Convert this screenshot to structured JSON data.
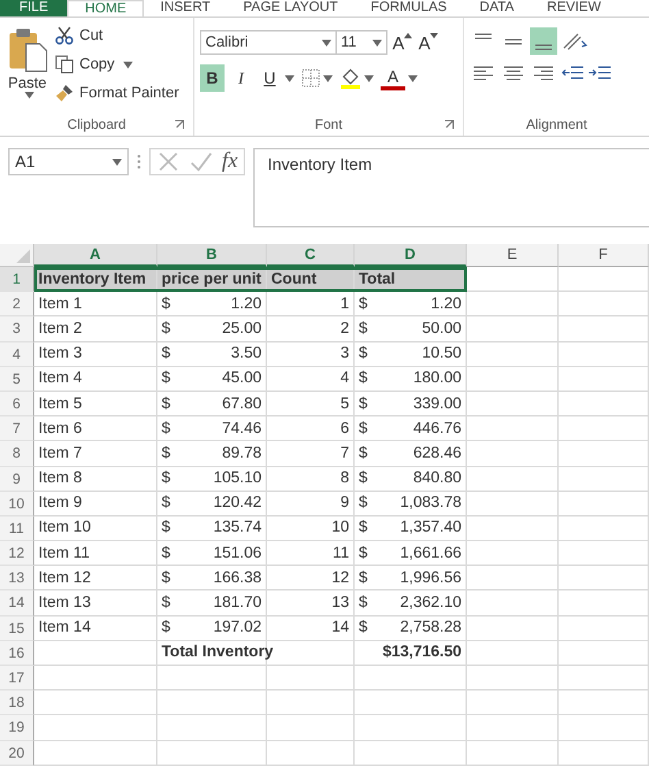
{
  "tabs": [
    {
      "label": "FILE",
      "kind": "file",
      "selected": false
    },
    {
      "label": "HOME",
      "kind": "tab",
      "selected": true
    },
    {
      "label": "INSERT",
      "kind": "tab",
      "selected": false
    },
    {
      "label": "PAGE LAYOUT",
      "kind": "tab",
      "selected": false
    },
    {
      "label": "FORMULAS",
      "kind": "tab",
      "selected": false
    },
    {
      "label": "DATA",
      "kind": "tab",
      "selected": false
    },
    {
      "label": "REVIEW",
      "kind": "tab",
      "selected": false
    }
  ],
  "clipboard": {
    "paste": "Paste",
    "cut": "Cut",
    "copy": "Copy",
    "format_painter": "Format Painter",
    "label": "Clipboard"
  },
  "font": {
    "name": "Calibri",
    "size": "11",
    "grow": "A",
    "shrink": "A",
    "bold": {
      "label": "B",
      "selected": true
    },
    "italic": {
      "label": "I",
      "selected": false
    },
    "underline": {
      "label": "U",
      "selected": false
    },
    "color_letter": "A",
    "label": "Font"
  },
  "alignment": {
    "vertical": [
      {
        "selected": false
      },
      {
        "selected": false
      },
      {
        "selected": true
      }
    ],
    "horizontal": [
      {
        "selected": false
      },
      {
        "selected": false
      },
      {
        "selected": false
      }
    ],
    "label": "Alignment"
  },
  "name_box": "A1",
  "fx": "fx",
  "formula": "Inventory Item",
  "columns": [
    {
      "letter": "A",
      "selected": true
    },
    {
      "letter": "B",
      "selected": true
    },
    {
      "letter": "C",
      "selected": true
    },
    {
      "letter": "D",
      "selected": true
    },
    {
      "letter": "E",
      "selected": false
    },
    {
      "letter": "F",
      "selected": false
    }
  ],
  "rows": [
    {
      "number": "1",
      "kind": "header",
      "selected": true,
      "cells": [
        {
          "kind": "text",
          "text": "Inventory Item"
        },
        {
          "kind": "text",
          "text": "price per unit"
        },
        {
          "kind": "text",
          "text": "Count"
        },
        {
          "kind": "text",
          "text": "Total"
        }
      ]
    },
    {
      "number": "2",
      "kind": "data",
      "selected": false,
      "cells": [
        {
          "kind": "text",
          "text": "Item 1"
        },
        {
          "kind": "currency",
          "sign": "$",
          "text": "1.20"
        },
        {
          "kind": "number",
          "text": "1"
        },
        {
          "kind": "currency",
          "sign": "$",
          "text": "1.20"
        }
      ]
    },
    {
      "number": "3",
      "kind": "data",
      "selected": false,
      "cells": [
        {
          "kind": "text",
          "text": "Item 2"
        },
        {
          "kind": "currency",
          "sign": "$",
          "text": "25.00"
        },
        {
          "kind": "number",
          "text": "2"
        },
        {
          "kind": "currency",
          "sign": "$",
          "text": "50.00"
        }
      ]
    },
    {
      "number": "4",
      "kind": "data",
      "selected": false,
      "cells": [
        {
          "kind": "text",
          "text": "Item 3"
        },
        {
          "kind": "currency",
          "sign": "$",
          "text": "3.50"
        },
        {
          "kind": "number",
          "text": "3"
        },
        {
          "kind": "currency",
          "sign": "$",
          "text": "10.50"
        }
      ]
    },
    {
      "number": "5",
      "kind": "data",
      "selected": false,
      "cells": [
        {
          "kind": "text",
          "text": "Item 4"
        },
        {
          "kind": "currency",
          "sign": "$",
          "text": "45.00"
        },
        {
          "kind": "number",
          "text": "4"
        },
        {
          "kind": "currency",
          "sign": "$",
          "text": "180.00"
        }
      ]
    },
    {
      "number": "6",
      "kind": "data",
      "selected": false,
      "cells": [
        {
          "kind": "text",
          "text": "Item 5"
        },
        {
          "kind": "currency",
          "sign": "$",
          "text": "67.80"
        },
        {
          "kind": "number",
          "text": "5"
        },
        {
          "kind": "currency",
          "sign": "$",
          "text": "339.00"
        }
      ]
    },
    {
      "number": "7",
      "kind": "data",
      "selected": false,
      "cells": [
        {
          "kind": "text",
          "text": "Item 6"
        },
        {
          "kind": "currency",
          "sign": "$",
          "text": "74.46"
        },
        {
          "kind": "number",
          "text": "6"
        },
        {
          "kind": "currency",
          "sign": "$",
          "text": "446.76"
        }
      ]
    },
    {
      "number": "8",
      "kind": "data",
      "selected": false,
      "cells": [
        {
          "kind": "text",
          "text": "Item 7"
        },
        {
          "kind": "currency",
          "sign": "$",
          "text": "89.78"
        },
        {
          "kind": "number",
          "text": "7"
        },
        {
          "kind": "currency",
          "sign": "$",
          "text": "628.46"
        }
      ]
    },
    {
      "number": "9",
      "kind": "data",
      "selected": false,
      "cells": [
        {
          "kind": "text",
          "text": "Item 8"
        },
        {
          "kind": "currency",
          "sign": "$",
          "text": "105.10"
        },
        {
          "kind": "number",
          "text": "8"
        },
        {
          "kind": "currency",
          "sign": "$",
          "text": "840.80"
        }
      ]
    },
    {
      "number": "10",
      "kind": "data",
      "selected": false,
      "cells": [
        {
          "kind": "text",
          "text": "Item 9"
        },
        {
          "kind": "currency",
          "sign": "$",
          "text": "120.42"
        },
        {
          "kind": "number",
          "text": "9"
        },
        {
          "kind": "currency",
          "sign": "$",
          "text": "1,083.78"
        }
      ]
    },
    {
      "number": "11",
      "kind": "data",
      "selected": false,
      "cells": [
        {
          "kind": "text",
          "text": "Item 10"
        },
        {
          "kind": "currency",
          "sign": "$",
          "text": "135.74"
        },
        {
          "kind": "number",
          "text": "10"
        },
        {
          "kind": "currency",
          "sign": "$",
          "text": "1,357.40"
        }
      ]
    },
    {
      "number": "12",
      "kind": "data",
      "selected": false,
      "cells": [
        {
          "kind": "text",
          "text": "Item 11"
        },
        {
          "kind": "currency",
          "sign": "$",
          "text": "151.06"
        },
        {
          "kind": "number",
          "text": "11"
        },
        {
          "kind": "currency",
          "sign": "$",
          "text": "1,661.66"
        }
      ]
    },
    {
      "number": "13",
      "kind": "data",
      "selected": false,
      "cells": [
        {
          "kind": "text",
          "text": "Item 12"
        },
        {
          "kind": "currency",
          "sign": "$",
          "text": "166.38"
        },
        {
          "kind": "number",
          "text": "12"
        },
        {
          "kind": "currency",
          "sign": "$",
          "text": "1,996.56"
        }
      ]
    },
    {
      "number": "14",
      "kind": "data",
      "selected": false,
      "cells": [
        {
          "kind": "text",
          "text": "Item 13"
        },
        {
          "kind": "currency",
          "sign": "$",
          "text": "181.70"
        },
        {
          "kind": "number",
          "text": "13"
        },
        {
          "kind": "currency",
          "sign": "$",
          "text": "2,362.10"
        }
      ]
    },
    {
      "number": "15",
      "kind": "data",
      "selected": false,
      "cells": [
        {
          "kind": "text",
          "text": "Item 14"
        },
        {
          "kind": "currency",
          "sign": "$",
          "text": "197.02"
        },
        {
          "kind": "number",
          "text": "14"
        },
        {
          "kind": "currency",
          "sign": "$",
          "text": "2,758.28"
        }
      ]
    },
    {
      "number": "16",
      "kind": "total",
      "selected": false,
      "cells": [
        {
          "kind": "empty"
        },
        {
          "kind": "text",
          "text": "Total Inventory"
        },
        {
          "kind": "empty"
        },
        {
          "kind": "number",
          "text": "$13,716.50"
        }
      ]
    },
    {
      "number": "17",
      "kind": "data",
      "selected": false,
      "cells": []
    },
    {
      "number": "18",
      "kind": "data",
      "selected": false,
      "cells": []
    },
    {
      "number": "19",
      "kind": "data",
      "selected": false,
      "cells": []
    },
    {
      "number": "20",
      "kind": "data",
      "selected": false,
      "cells": []
    }
  ]
}
